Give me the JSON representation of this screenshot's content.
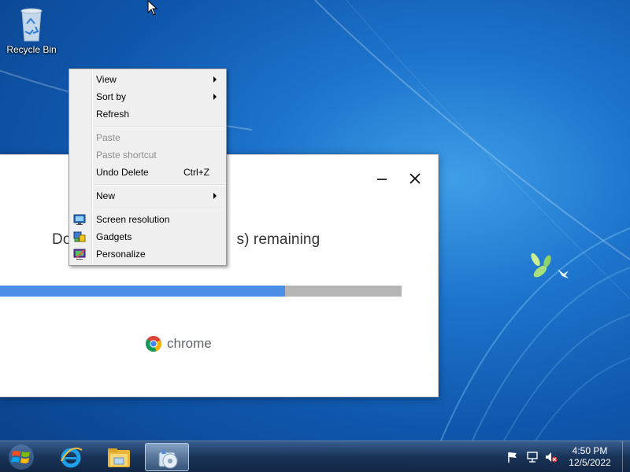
{
  "desktop": {
    "recycle_bin_label": "Recycle Bin"
  },
  "installer": {
    "status_left": "Do",
    "status_right": "s) remaining",
    "progress_fraction": 0.71,
    "brand_name": "chrome",
    "accent_color": "#4a8ee8",
    "track_color": "#b5b5b5"
  },
  "context_menu": {
    "items": [
      {
        "label": "View",
        "submenu": true
      },
      {
        "label": "Sort by",
        "submenu": true
      },
      {
        "label": "Refresh"
      },
      {
        "label": "Paste",
        "disabled": true
      },
      {
        "label": "Paste shortcut",
        "disabled": true
      },
      {
        "label": "Undo Delete",
        "shortcut": "Ctrl+Z"
      },
      {
        "label": "New",
        "submenu": true
      },
      {
        "label": "Screen resolution",
        "icon": "screen-resolution-icon"
      },
      {
        "label": "Gadgets",
        "icon": "gadgets-icon"
      },
      {
        "label": "Personalize",
        "icon": "personalize-icon"
      }
    ]
  },
  "taskbar": {
    "pinned": [
      "internet-explorer-icon",
      "file-explorer-icon",
      "installer-icon"
    ],
    "tray_icons": [
      "action-center-flag-icon",
      "network-icon",
      "volume-muted-icon"
    ],
    "clock_time": "4:50 PM",
    "clock_date": "12/5/2022"
  }
}
